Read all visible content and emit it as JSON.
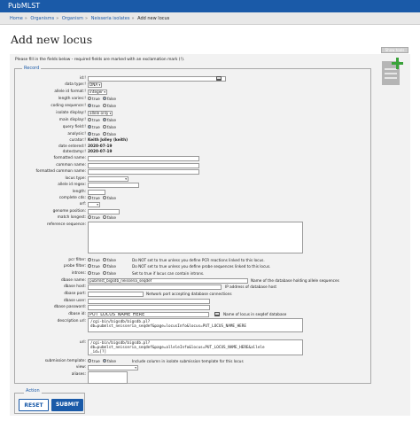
{
  "app": {
    "brand": "PubMLST"
  },
  "breadcrumb": [
    "Home",
    "Organisms",
    "Organism",
    "Neisseria isolates",
    "Add new locus"
  ],
  "page": {
    "title": "Add new locus",
    "show_tools": "Show tools",
    "notice": "Please fill in the fields below - required fields are marked with an exclamation mark (!)."
  },
  "sections": {
    "record": "Record",
    "action": "Action"
  },
  "fields": {
    "id": {
      "label": "id:!",
      "value": ""
    },
    "data_type": {
      "label": "data type:!",
      "value": "DNA"
    },
    "allele_id_format": {
      "label": "allele id format:!",
      "value": "integer"
    },
    "length_varies": {
      "label": "length varies:!",
      "opt_true": "true",
      "opt_false": "false",
      "selected": "false"
    },
    "coding_sequence": {
      "label": "coding sequence:!",
      "opt_true": "true",
      "opt_false": "false",
      "selected": "true"
    },
    "isolate_display": {
      "label": "isolate display:!",
      "value": "allele only"
    },
    "main_display": {
      "label": "main display:!",
      "opt_true": "true",
      "opt_false": "false",
      "selected": "false"
    },
    "query_field": {
      "label": "query field:!",
      "opt_true": "true",
      "opt_false": "false",
      "selected": "true"
    },
    "analysis": {
      "label": "analysis:!",
      "opt_true": "true",
      "opt_false": "false",
      "selected": "true"
    },
    "curator": {
      "label": "curator:!",
      "value": "Keith Jolley (keith)"
    },
    "date_entered": {
      "label": "date entered:!",
      "value": "2020-07-19"
    },
    "datestamp": {
      "label": "datestamp:!",
      "value": "2020-07-19"
    },
    "formatted_name": {
      "label": "formatted name:",
      "value": ""
    },
    "common_name": {
      "label": "common name:",
      "value": ""
    },
    "formatted_common_name": {
      "label": "formatted common name:",
      "value": ""
    },
    "locus_type": {
      "label": "locus type:",
      "value": ""
    },
    "allele_id_regex": {
      "label": "allele id regex:",
      "value": ""
    },
    "length": {
      "label": "length:",
      "value": ""
    },
    "complete_cds": {
      "label": "complete cds:",
      "opt_true": "true",
      "opt_false": "false"
    },
    "orf": {
      "label": "orf:",
      "value": ""
    },
    "genome_position": {
      "label": "genome position:",
      "value": ""
    },
    "match_longest": {
      "label": "match longest:",
      "opt_true": "true",
      "opt_false": "false"
    },
    "reference_sequence": {
      "label": "reference sequence:",
      "value": ""
    },
    "pcr_filter": {
      "label": "pcr filter:",
      "opt_true": "true",
      "opt_false": "false",
      "note": "Do NOT set to true unless you define PCR reactions linked to this locus."
    },
    "probe_filter": {
      "label": "probe filter:",
      "opt_true": "true",
      "opt_false": "false",
      "note": "Do NOT set to true unless you define probe sequences linked to this locus."
    },
    "introns": {
      "label": "introns:",
      "opt_true": "true",
      "opt_false": "false",
      "note": "Set to true if locus can contain introns."
    },
    "dbase_name": {
      "label": "dbase name:",
      "value": "pubmlst_bigsdb_neisseria_seqdef",
      "note": "Name of the database holding allele sequences"
    },
    "dbase_host": {
      "label": "dbase host:",
      "value": "",
      "note": "IP address of database host"
    },
    "dbase_port": {
      "label": "dbase port:",
      "value": "",
      "note": "Network port accepting database connections"
    },
    "dbase_user": {
      "label": "dbase user:",
      "value": ""
    },
    "dbase_password": {
      "label": "dbase password:",
      "value": ""
    },
    "dbase_id": {
      "label": "dbase id:",
      "value": "PUT_LOCUS_NAME_HERE",
      "note": "Name of locus in seqdef database"
    },
    "description_url": {
      "label": "description url:",
      "value": "/cgi-bin/bigsdb/bigsdb.pl?\ndb=pubmlst_neisseria_seqdef&page=locusInfo&locus=PUT_LOCUS_NAME_HERE"
    },
    "url": {
      "label": "url:",
      "value": "/cgi-bin/bigsdb/bigsdb.pl?\ndb=pubmlst_neisseria_seqdef&page=alleleInfo&locus=PUT_LOCUS_NAME_HERE&allele\n_id=[?]"
    },
    "submission_template": {
      "label": "submission template:",
      "opt_true": "true",
      "opt_false": "false",
      "selected": "false",
      "note": "Include column in isolate submission template for this locus"
    },
    "view": {
      "label": "view:",
      "value": ""
    },
    "aliases": {
      "label": "aliases:",
      "value": ""
    }
  },
  "buttons": {
    "reset": "RESET",
    "submit": "SUBMIT"
  },
  "colors": {
    "header": "#1a5aa8",
    "panel": "#f2f2f2"
  }
}
